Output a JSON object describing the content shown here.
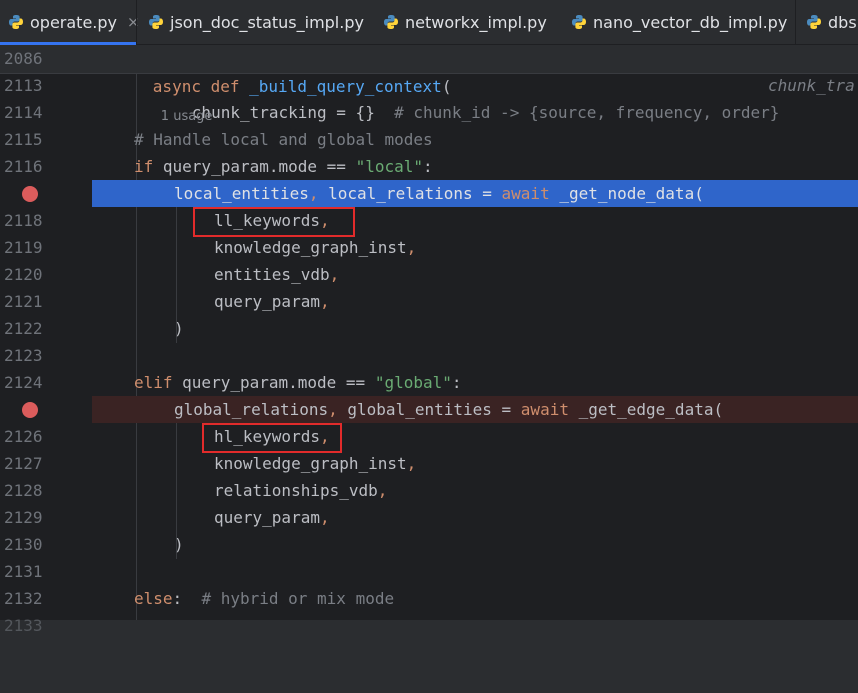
{
  "tabs": [
    {
      "label": "operate.py",
      "active": true,
      "close": "×"
    },
    {
      "label": "json_doc_status_impl.py"
    },
    {
      "label": "networkx_impl.py"
    },
    {
      "label": "nano_vector_db_impl.py"
    },
    {
      "label": "dbs."
    }
  ],
  "sticky": {
    "num": "2086",
    "async": "async",
    "def": "def",
    "fn": "_build_query_context",
    "paren": "(",
    "hint": "1 usage"
  },
  "lines": [
    {
      "num": "2113",
      "t1": "chunk_tracking = {}  ",
      "t2": "# chunk_id -> {source, frequency, order}",
      "t3": "chunk_tra"
    },
    {
      "num": "2114"
    },
    {
      "num": "2115",
      "t1": "# Handle local and global modes"
    },
    {
      "num": "2116",
      "t1": "if",
      "t2": " query_param.mode == ",
      "t3": "\"local\"",
      "t4": ":"
    },
    {
      "num": "",
      "t1": "local_entities",
      "t2": ",",
      "t3": " local_relations = ",
      "t4": "await",
      "t5": " _get_node_data("
    },
    {
      "num": "2118",
      "t1": "ll_keywords",
      "t2": ","
    },
    {
      "num": "2119",
      "t1": "knowledge_graph_inst",
      "t2": ","
    },
    {
      "num": "2120",
      "t1": "entities_vdb",
      "t2": ","
    },
    {
      "num": "2121",
      "t1": "query_param",
      "t2": ","
    },
    {
      "num": "2122",
      "t1": ")"
    },
    {
      "num": "2123"
    },
    {
      "num": "2124",
      "t1": "elif",
      "t2": " query_param.mode == ",
      "t3": "\"global\"",
      "t4": ":"
    },
    {
      "num": "",
      "t1": "global_relations",
      "t2": ",",
      "t3": " global_entities = ",
      "t4": "await",
      "t5": " _get_edge_data("
    },
    {
      "num": "2126",
      "t1": "hl_keywords",
      "t2": ","
    },
    {
      "num": "2127",
      "t1": "knowledge_graph_inst",
      "t2": ","
    },
    {
      "num": "2128",
      "t1": "relationships_vdb",
      "t2": ","
    },
    {
      "num": "2129",
      "t1": "query_param",
      "t2": ","
    },
    {
      "num": "2130",
      "t1": ")"
    },
    {
      "num": "2131"
    },
    {
      "num": "2132",
      "t1": "else",
      "t2": ":  ",
      "t3": "# hybrid or mix mode"
    },
    {
      "num": "2133"
    }
  ],
  "colors": {
    "accent": "#3574f0",
    "breakpoint": "#db5c5c",
    "highlight_box": "#e22b2b"
  }
}
